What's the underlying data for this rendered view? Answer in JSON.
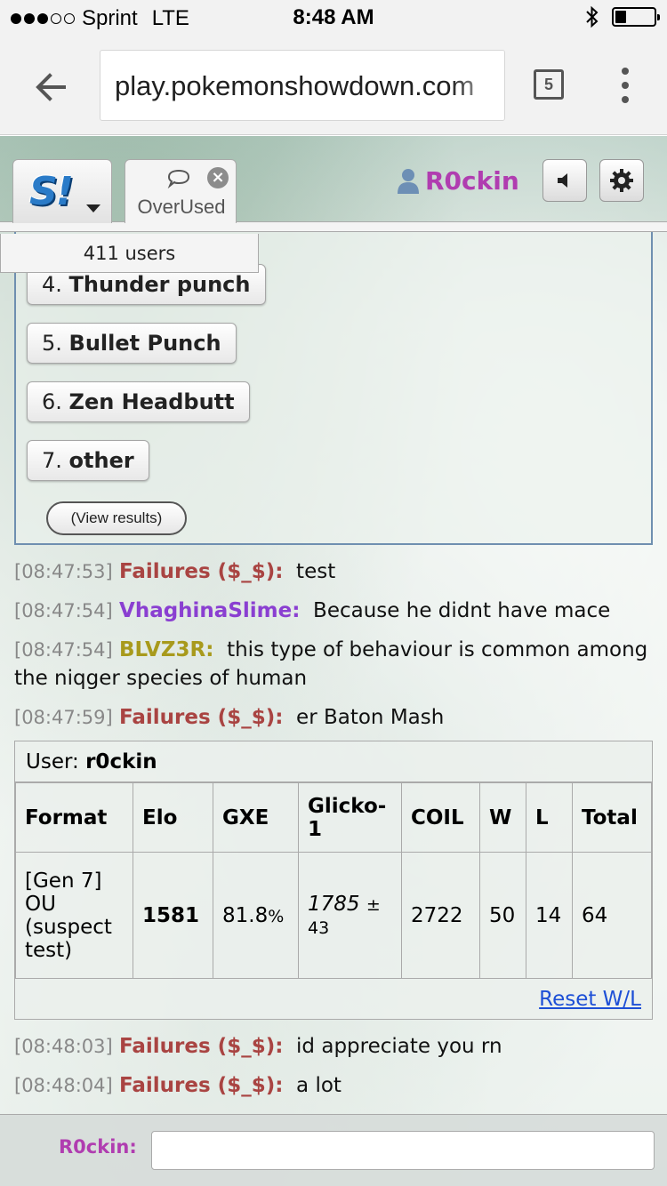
{
  "status_bar": {
    "carrier": "Sprint",
    "network": "LTE",
    "time": "8:48 AM",
    "signal_bars_filled": 3,
    "signal_bars_total": 5
  },
  "browser": {
    "url": "play.pokemonshowdown.com",
    "tab_count": "5"
  },
  "header": {
    "room_tab_label": "OverUsed",
    "username": "R0ckin",
    "users_count": "411 users"
  },
  "poll": {
    "options": [
      {
        "num": "4.",
        "text": "Thunder punch"
      },
      {
        "num": "5.",
        "text": "Bullet Punch"
      },
      {
        "num": "6.",
        "text": "Zen Headbutt"
      },
      {
        "num": "7.",
        "text": "other"
      }
    ],
    "view_results_label": "(View results)"
  },
  "chat_top": [
    {
      "time": "[08:47:53]",
      "user": "Failures ($_$):",
      "color": "#a94442",
      "msg": "test"
    },
    {
      "time": "[08:47:54]",
      "user": "VhaghinaSlime:",
      "color": "#8a3fd1",
      "msg": "Because he didnt have mace"
    },
    {
      "time": "[08:47:54]",
      "user": "BLVZ3R:",
      "color": "#a89a1c",
      "msg": "this type of behaviour is common among the niqger species of human"
    },
    {
      "time": "[08:47:59]",
      "user": "Failures ($_$):",
      "color": "#a94442",
      "msg": "er Baton Mash"
    }
  ],
  "rank": {
    "user_label": "User:",
    "user_name": "r0ckin",
    "headers": [
      "Format",
      "Elo",
      "GXE",
      "Glicko-1",
      "COIL",
      "W",
      "L",
      "Total"
    ],
    "row": {
      "format": "[Gen 7] OU (suspect test)",
      "elo": "1581",
      "gxe": "81.8",
      "gxe_unit": "%",
      "glicko": "1785",
      "glicko_pm": "± 43",
      "coil": "2722",
      "w": "50",
      "l": "14",
      "total": "64"
    },
    "reset_label": "Reset W/L"
  },
  "chat_bottom": [
    {
      "time": "[08:48:03]",
      "user": "Failures ($_$):",
      "color": "#a94442",
      "msg": "id appreciate you rn"
    },
    {
      "time": "[08:48:04]",
      "user": "Failures ($_$):",
      "color": "#a94442",
      "msg": "a lot"
    }
  ],
  "input": {
    "label": "R0ckin:",
    "value": ""
  },
  "colors": {
    "username": "#b03db0",
    "link": "#1d4fd6"
  }
}
